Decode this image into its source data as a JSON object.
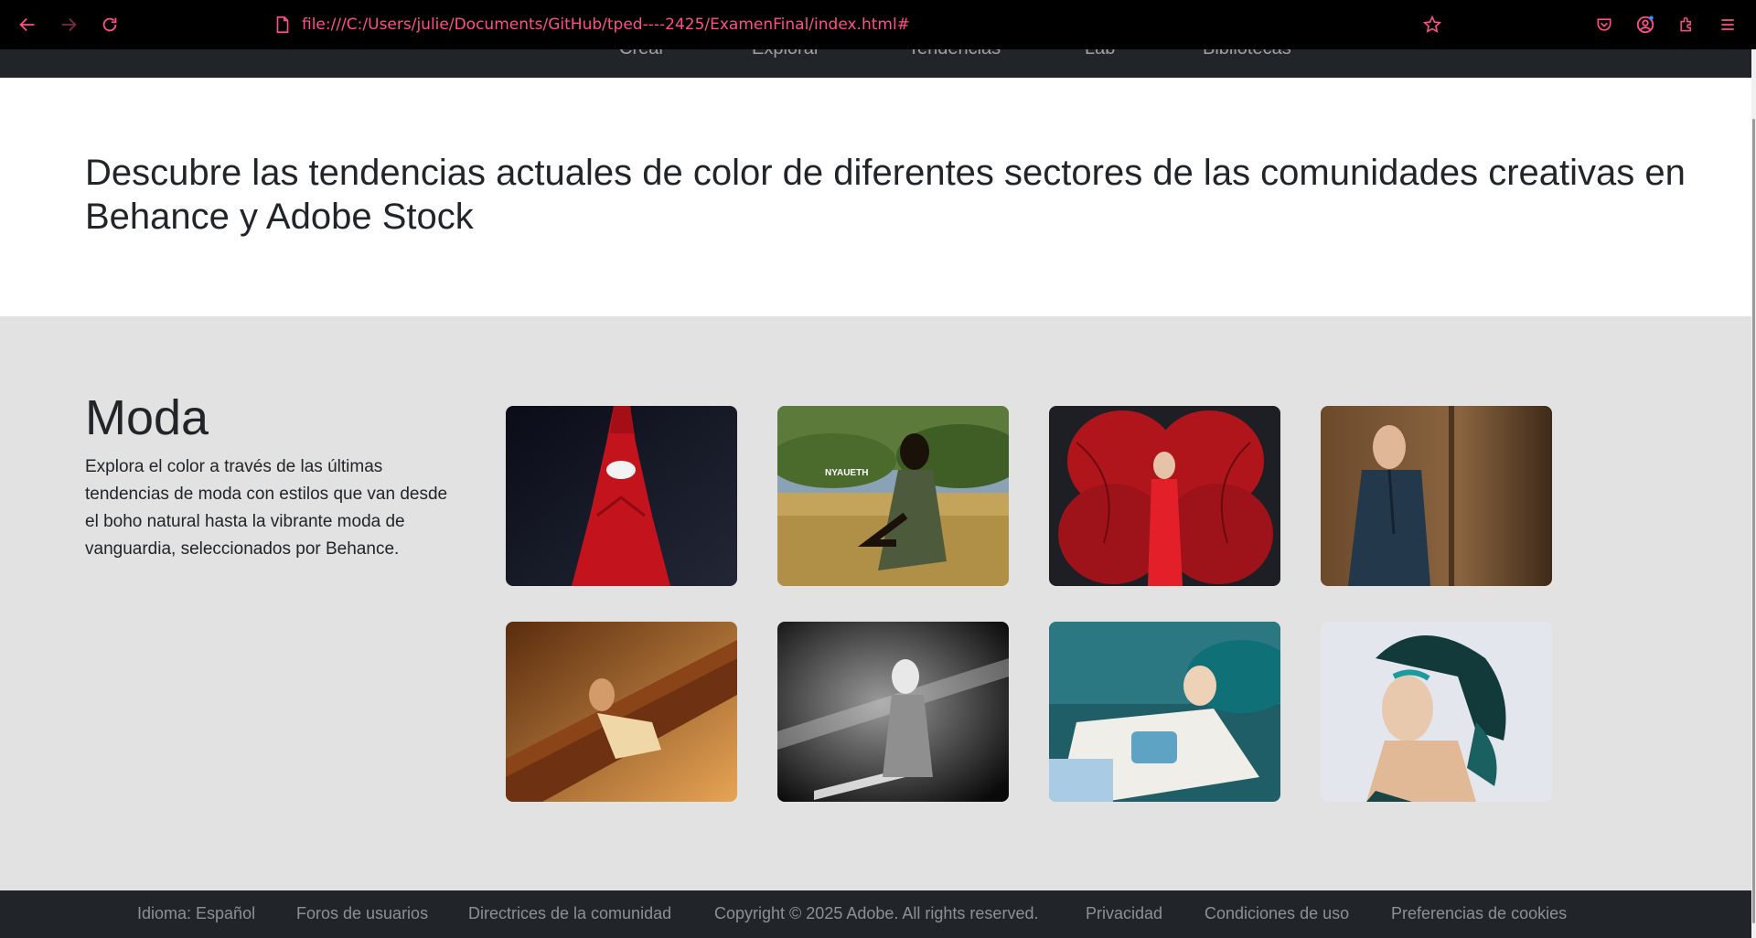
{
  "browser": {
    "url": "file:///C:/Users/julie/Documents/GitHub/tped----2425/ExamenFinal/index.html#",
    "accent": "#ff4f8b"
  },
  "nav": {
    "items": [
      "Crear",
      "Explorar",
      "Tendencias",
      "Lab",
      "Bibliotecas"
    ]
  },
  "hero": {
    "title": "Descubre las tendencias actuales de color de diferentes sectores de las comunidades creativas en Behance y Adobe Stock"
  },
  "section": {
    "title": "Moda",
    "description": "Explora el color a través de las últimas tendencias de moda con estilos que van desde el boho natural hasta la vibrante moda de vanguardia, seleccionados por Behance.",
    "gallery": [
      {
        "icon": "fashion-photo-red-gown",
        "label": ""
      },
      {
        "icon": "fashion-photo-field-dress",
        "label": "NYAUETH"
      },
      {
        "icon": "fashion-photo-red-flower",
        "label": ""
      },
      {
        "icon": "fashion-photo-wood-coat",
        "label": ""
      },
      {
        "icon": "fashion-photo-railing",
        "label": ""
      },
      {
        "icon": "fashion-photo-monochrome",
        "label": ""
      },
      {
        "icon": "fashion-photo-teal-sofa",
        "label": ""
      },
      {
        "icon": "fashion-photo-teal-hair",
        "label": ""
      }
    ]
  },
  "footer": {
    "links": [
      "Idioma: Español",
      "Foros de usuarios",
      "Directrices de la comunidad",
      "Copyright © 2025 Adobe. All rights reserved.",
      "Privacidad",
      "Condiciones de uso",
      "Preferencias de cookies"
    ]
  }
}
